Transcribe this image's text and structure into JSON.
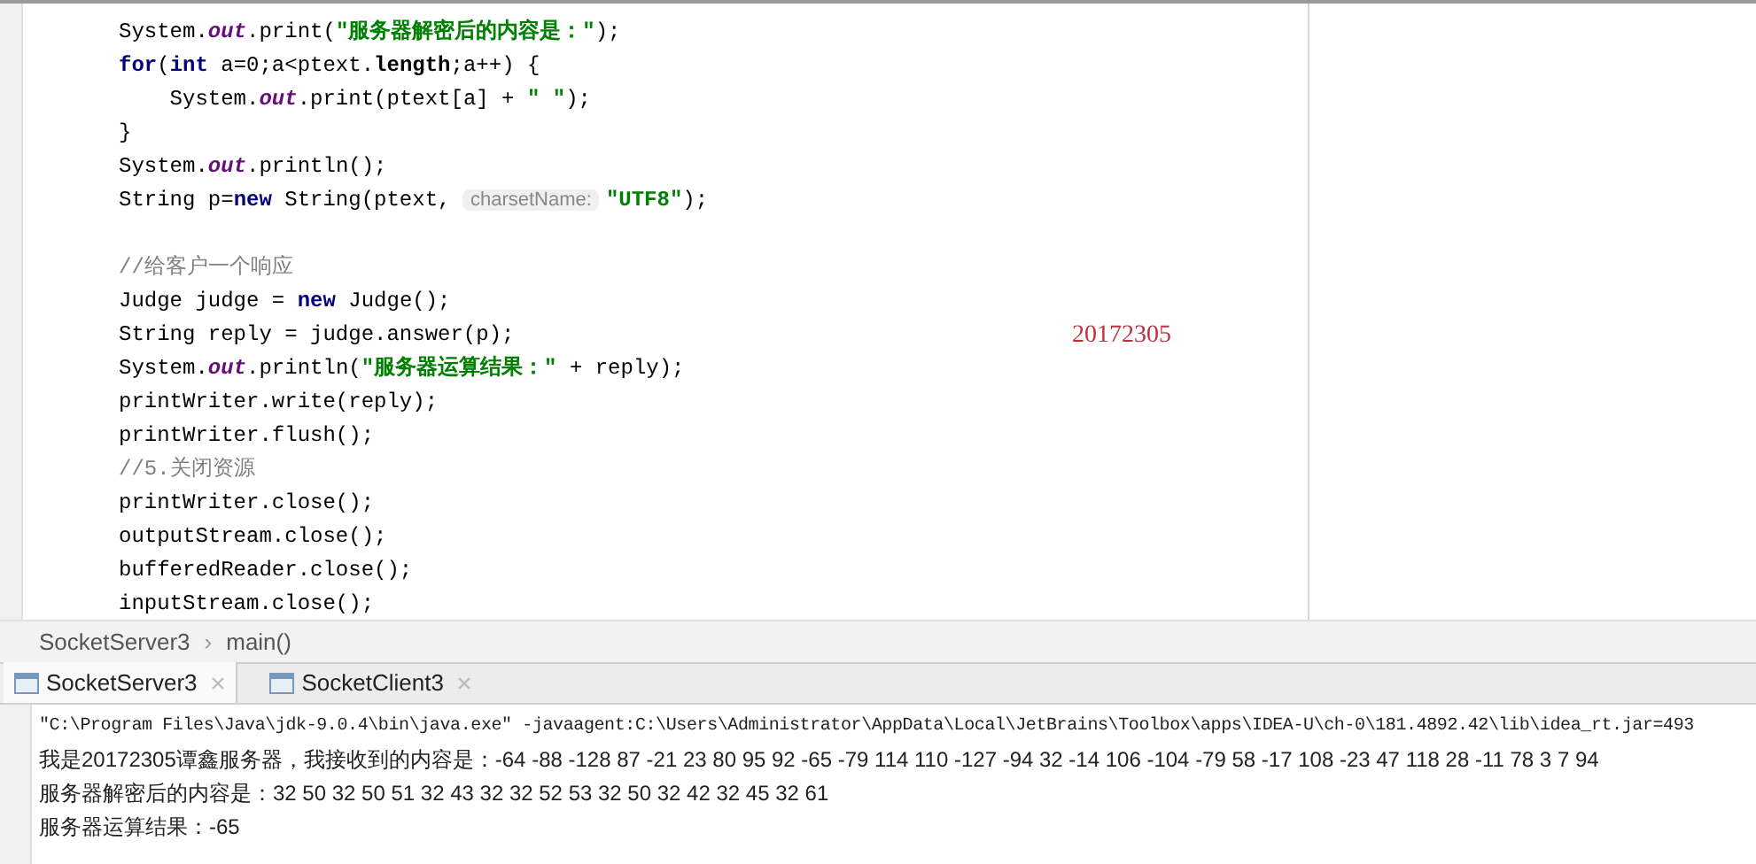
{
  "editor": {
    "lines": [
      {
        "tokens": [
          {
            "kind": "plain",
            "text": "System."
          },
          {
            "kind": "field",
            "text": "out"
          },
          {
            "kind": "plain",
            "text": ".print("
          },
          {
            "kind": "string",
            "text": "\"服务器解密后的内容是：\""
          },
          {
            "kind": "plain",
            "text": ");"
          }
        ]
      },
      {
        "tokens": [
          {
            "kind": "keyword",
            "text": "for"
          },
          {
            "kind": "plain",
            "text": "("
          },
          {
            "kind": "keyword",
            "text": "int"
          },
          {
            "kind": "plain",
            "text": " a=0;a<ptext."
          },
          {
            "kind": "bold",
            "text": "length"
          },
          {
            "kind": "plain",
            "text": ";a++) {"
          }
        ]
      },
      {
        "tokens": [
          {
            "kind": "plain",
            "text": "    System."
          },
          {
            "kind": "field",
            "text": "out"
          },
          {
            "kind": "plain",
            "text": ".print(ptext[a] + "
          },
          {
            "kind": "string",
            "text": "\" \""
          },
          {
            "kind": "plain",
            "text": ");"
          }
        ]
      },
      {
        "tokens": [
          {
            "kind": "plain",
            "text": "}"
          }
        ]
      },
      {
        "tokens": [
          {
            "kind": "plain",
            "text": "System."
          },
          {
            "kind": "field",
            "text": "out"
          },
          {
            "kind": "plain",
            "text": ".println();"
          }
        ]
      },
      {
        "tokens": [
          {
            "kind": "plain",
            "text": "String p="
          },
          {
            "kind": "keyword",
            "text": "new"
          },
          {
            "kind": "plain",
            "text": " String(ptext, "
          },
          {
            "kind": "hint",
            "text": "charsetName:"
          },
          {
            "kind": "string",
            "text": "\"UTF8\""
          },
          {
            "kind": "plain",
            "text": ");"
          }
        ]
      },
      {
        "spaced": true,
        "tokens": [
          {
            "kind": "comment",
            "text": "//给客户一个响应"
          }
        ]
      },
      {
        "tokens": [
          {
            "kind": "plain",
            "text": "Judge judge = "
          },
          {
            "kind": "keyword",
            "text": "new"
          },
          {
            "kind": "plain",
            "text": " Judge();"
          }
        ]
      },
      {
        "tokens": [
          {
            "kind": "plain",
            "text": "String reply = judge.answer(p);"
          }
        ]
      },
      {
        "tokens": [
          {
            "kind": "plain",
            "text": "System."
          },
          {
            "kind": "field",
            "text": "out"
          },
          {
            "kind": "plain",
            "text": ".println("
          },
          {
            "kind": "string",
            "text": "\"服务器运算结果：\""
          },
          {
            "kind": "plain",
            "text": " + reply);"
          }
        ]
      },
      {
        "tokens": [
          {
            "kind": "plain",
            "text": "printWriter.write(reply);"
          }
        ]
      },
      {
        "tokens": [
          {
            "kind": "plain",
            "text": "printWriter.flush();"
          }
        ]
      },
      {
        "tokens": [
          {
            "kind": "comment",
            "text": "//5.关闭资源"
          }
        ]
      },
      {
        "tokens": [
          {
            "kind": "plain",
            "text": "printWriter.close();"
          }
        ]
      },
      {
        "tokens": [
          {
            "kind": "plain",
            "text": "outputStream.close();"
          }
        ]
      },
      {
        "tokens": [
          {
            "kind": "plain",
            "text": "bufferedReader.close();"
          }
        ]
      },
      {
        "tokens": [
          {
            "kind": "plain",
            "text": "inputStream.close();"
          }
        ]
      }
    ],
    "annotation": "20172305"
  },
  "breadcrumb": [
    "SocketServer3",
    "main()"
  ],
  "breadcrumb_separator": "›",
  "run_tabs": [
    {
      "label": "SocketServer3",
      "selected": true
    },
    {
      "label": "SocketClient3",
      "selected": false
    }
  ],
  "console": [
    "\"C:\\Program Files\\Java\\jdk-9.0.4\\bin\\java.exe\" -javaagent:C:\\Users\\Administrator\\AppData\\Local\\JetBrains\\Toolbox\\apps\\IDEA-U\\ch-0\\181.4892.42\\lib\\idea_rt.jar=493",
    "我是20172305谭鑫服务器，我接收到的内容是：-64 -88 -128 87 -21 23 80 95 92 -65 -79 114 110 -127 -94 32 -14 106 -104 -79 58 -17 108 -23 47 118 28 -11 78 3 7 94",
    "服务器解密后的内容是：32 50 32 50 51 32 43 32 32 52 53 32 50 32 42 32 45 32 61",
    "服务器运算结果：-65"
  ]
}
